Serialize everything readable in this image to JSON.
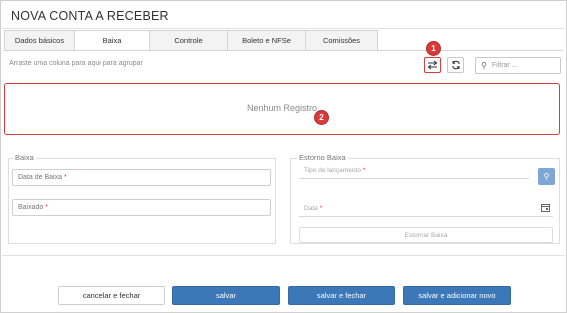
{
  "window": {
    "title": "NOVA CONTA A RECEBER"
  },
  "tabs": [
    {
      "label": "Dados básicos",
      "active": false
    },
    {
      "label": "Baixa",
      "active": true
    },
    {
      "label": "Controle",
      "active": false
    },
    {
      "label": "Boleto e NFSe",
      "active": false
    },
    {
      "label": "Comissões",
      "active": false
    }
  ],
  "grid": {
    "group_hint": "Arraste uma coluna para aqui para agrupar",
    "filter_placeholder": "Filtrar ...",
    "empty_message": "Nenhum Registro",
    "toggle_icon": "swap-arrows-icon",
    "refresh_icon": "refresh-icon"
  },
  "callouts": {
    "one": "1",
    "two": "2",
    "color": "#d93a3a"
  },
  "baixa": {
    "legend": "Baixa",
    "data_baixa_label": "Data de Baixa",
    "baixado_label": "Baixado",
    "required_mark": "*"
  },
  "estorno": {
    "legend": "Estorno Baixa",
    "tipo_lancamento_label": "Tipo de lançamento",
    "data_label": "Data",
    "required_mark": "*",
    "button_label": "Estornar Baixa"
  },
  "footer": {
    "cancel_label": "cancelar e fechar",
    "save_label": "salvar",
    "save_close_label": "salvar e fechar",
    "save_new_label": "salvar e adicionar novo"
  },
  "colors": {
    "primary": "#3c78b8",
    "search_button": "#7fa7d6",
    "highlight": "#d93a3a"
  }
}
